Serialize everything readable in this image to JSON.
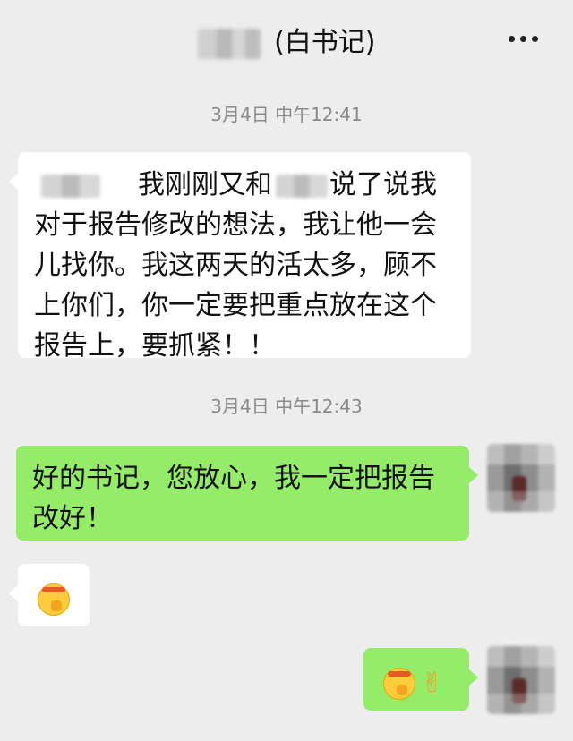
{
  "header": {
    "title": "(白书记)",
    "more_icon": "more-dots-icon"
  },
  "messages": [
    {
      "kind": "time",
      "text": "3月4日 中午12:41"
    },
    {
      "kind": "incoming",
      "parts": {
        "seg1": "我刚刚又和",
        "seg2": "说了说我对于报告修改的想法，我让他一会儿找你。我这两天的活太多，顾不上你们，你一定要把重点放在这个报告上，要抓紧！！"
      }
    },
    {
      "kind": "time",
      "text": "3月4日 中午12:43"
    },
    {
      "kind": "outgoing",
      "text": "好的书记，您放心，我一定把报告改好！"
    },
    {
      "kind": "incoming-emoji",
      "emoji": "determined-face-emoji"
    },
    {
      "kind": "outgoing-emoji",
      "emojis": [
        "determined-face-emoji",
        "victory-hand-emoji"
      ],
      "victory_glyph": "✌"
    }
  ],
  "colors": {
    "background": "#ededed",
    "incoming_bubble": "#ffffff",
    "outgoing_bubble": "#95ec69",
    "timestamp": "#8a8a8a"
  }
}
